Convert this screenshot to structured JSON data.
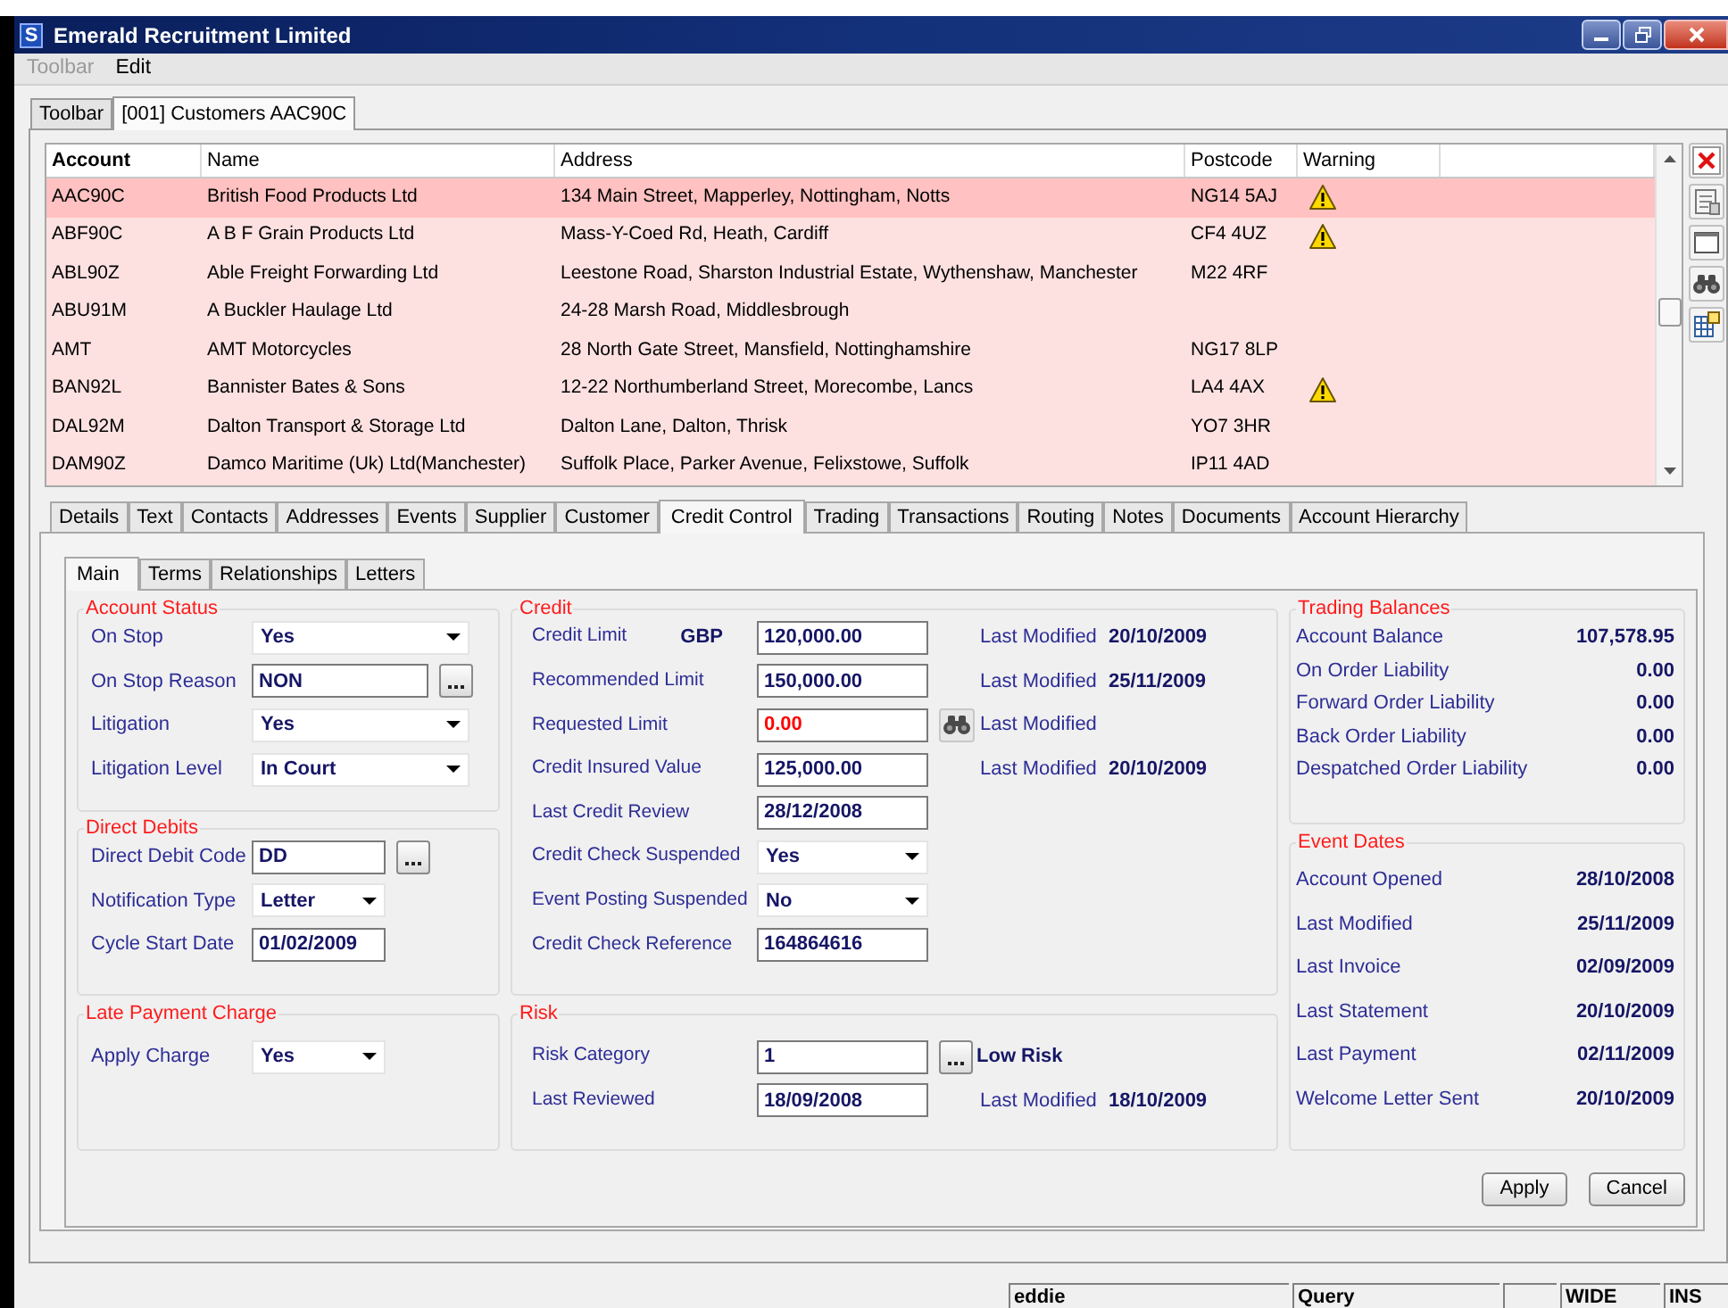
{
  "window": {
    "app_icon": "S",
    "title": "Emerald Recruitment Limited"
  },
  "menu": [
    {
      "label": "Toolbar",
      "disabled": true
    },
    {
      "label": "Edit",
      "disabled": false
    }
  ],
  "document_tabs": [
    {
      "label": "Toolbar",
      "selected": false
    },
    {
      "label": "[001] Customers AAC90C",
      "selected": true
    }
  ],
  "table": {
    "columns": [
      {
        "label": "Account",
        "sorted": true
      },
      {
        "label": "Name",
        "sorted": false
      },
      {
        "label": "Address",
        "sorted": false
      },
      {
        "label": "Postcode",
        "sorted": false
      },
      {
        "label": "Warning",
        "sorted": false
      }
    ],
    "rows": [
      {
        "account": "AAC90C",
        "name": "British Food Products Ltd",
        "address": "134 Main Street, Mapperley, Nottingham, Notts",
        "postcode": "NG14 5AJ",
        "warning": true,
        "selected": true
      },
      {
        "account": "ABF90C",
        "name": "A B F Grain Products Ltd",
        "address": "Mass-Y-Coed Rd, Heath, Cardiff",
        "postcode": "CF4 4UZ",
        "warning": true,
        "selected": false
      },
      {
        "account": "ABL90Z",
        "name": "Able Freight Forwarding Ltd",
        "address": "Leestone Road, Sharston Industrial Estate, Wythenshaw, Manchester",
        "postcode": "M22 4RF",
        "warning": false,
        "selected": false
      },
      {
        "account": "ABU91M",
        "name": "A Buckler Haulage Ltd",
        "address": "24-28 Marsh Road, Middlesbrough",
        "warning": false,
        "selected": false
      },
      {
        "account": "AMT",
        "name": "AMT Motorcycles",
        "address": "28 North Gate Street, Mansfield, Nottinghamshire",
        "postcode": "NG17 8LP",
        "warning": false,
        "selected": false
      },
      {
        "account": "BAN92L",
        "name": "Bannister Bates & Sons",
        "address": "12-22 Northumberland Street, Morecombe, Lancs",
        "postcode": "LA4 4AX",
        "warning": true,
        "selected": false
      },
      {
        "account": "DAL92M",
        "name": "Dalton Transport & Storage Ltd",
        "address": "Dalton Lane, Dalton, Thrisk",
        "postcode": "YO7 3HR",
        "warning": false,
        "selected": false
      },
      {
        "account": "DAM90Z",
        "name": "Damco Maritime (Uk) Ltd(Manchester)",
        "address": "Suffolk Place, Parker Avenue, Felixstowe, Suffolk",
        "postcode": "IP11 4AD",
        "warning": false,
        "selected": false
      }
    ]
  },
  "detail_tabs": [
    {
      "label": "Details",
      "selected": false
    },
    {
      "label": "Text",
      "selected": false
    },
    {
      "label": "Contacts",
      "selected": false
    },
    {
      "label": "Addresses",
      "selected": false
    },
    {
      "label": "Events",
      "selected": false
    },
    {
      "label": "Supplier",
      "selected": false
    },
    {
      "label": "Customer",
      "selected": false
    },
    {
      "label": "Credit Control",
      "selected": true
    },
    {
      "label": "Trading",
      "selected": false
    },
    {
      "label": "Transactions",
      "selected": false
    },
    {
      "label": "Routing",
      "selected": false
    },
    {
      "label": "Notes",
      "selected": false
    },
    {
      "label": "Documents",
      "selected": false
    },
    {
      "label": "Account Hierarchy",
      "selected": false
    }
  ],
  "sub_tabs": [
    {
      "label": "Main",
      "selected": true
    },
    {
      "label": "Terms",
      "selected": false
    },
    {
      "label": "Relationships",
      "selected": false
    },
    {
      "label": "Letters",
      "selected": false
    }
  ],
  "account_status": {
    "title": "Account Status",
    "fields": [
      {
        "label": "On Stop",
        "kind": "select",
        "value": "Yes"
      },
      {
        "label": "On Stop Reason",
        "kind": "lookup",
        "value": "NON"
      },
      {
        "label": "Litigation",
        "kind": "select",
        "value": "Yes"
      },
      {
        "label": "Litigation Level",
        "kind": "select",
        "value": "In Court"
      }
    ]
  },
  "direct_debits": {
    "title": "Direct Debits",
    "fields": [
      {
        "label": "Direct Debit Code",
        "kind": "lookup",
        "value": "DD"
      },
      {
        "label": "Notification Type",
        "kind": "select",
        "value": "Letter"
      },
      {
        "label": "Cycle Start Date",
        "kind": "input",
        "value": "01/02/2009"
      }
    ]
  },
  "late_payment_charge": {
    "title": "Late Payment Charge",
    "fields": [
      {
        "label": "Apply Charge",
        "kind": "select",
        "value": "Yes"
      }
    ]
  },
  "credit": {
    "title": "Credit",
    "rows": [
      {
        "label": "Credit Limit",
        "currency": "GBP",
        "kind": "input",
        "value": "120,000.00",
        "alert": false,
        "modified_label": "Last Modified",
        "modified_date": "20/10/2009"
      },
      {
        "label": "Recommended Limit",
        "kind": "input",
        "value": "150,000.00",
        "alert": false,
        "modified_label": "Last Modified",
        "modified_date": "25/11/2009"
      },
      {
        "label": "Requested Limit",
        "kind": "search",
        "value": "0.00",
        "alert": true,
        "modified_label": "Last Modified"
      },
      {
        "label": "Credit Insured Value",
        "kind": "input",
        "value": "125,000.00",
        "alert": false,
        "modified_label": "Last Modified",
        "modified_date": "20/10/2009"
      },
      {
        "label": "Last Credit Review",
        "kind": "input",
        "value": "28/12/2008",
        "alert": false
      },
      {
        "label": "Credit Check Suspended",
        "kind": "select",
        "value": "Yes",
        "alert": false
      },
      {
        "label": "Event Posting Suspended",
        "kind": "select",
        "value": "No",
        "alert": false
      },
      {
        "label": "Credit Check Reference",
        "kind": "input",
        "value": "164864616",
        "alert": false
      }
    ]
  },
  "risk": {
    "title": "Risk",
    "rows": [
      {
        "label": "Risk Category",
        "kind": "lookup",
        "value": "1",
        "description": "Low Risk",
        "alert": false
      },
      {
        "label": "Last Reviewed",
        "kind": "input",
        "value": "18/09/2008",
        "alert": false,
        "modified_label": "Last Modified",
        "modified_date": "18/10/2009"
      }
    ]
  },
  "trading_balances": {
    "title": "Trading Balances",
    "items": [
      {
        "label": "Account Balance",
        "value": "107,578.95"
      },
      {
        "label": "On Order Liability",
        "value": "0.00"
      },
      {
        "label": "Forward Order Liability",
        "value": "0.00"
      },
      {
        "label": "Back Order Liability",
        "value": "0.00"
      },
      {
        "label": "Despatched Order Liability",
        "value": "0.00"
      }
    ]
  },
  "event_dates": {
    "title": "Event Dates",
    "items": [
      {
        "label": "Account Opened",
        "value": "28/10/2008"
      },
      {
        "label": "Last Modified",
        "value": "25/11/2009"
      },
      {
        "label": "Last Invoice",
        "value": "02/09/2009"
      },
      {
        "label": "Last Statement",
        "value": "20/10/2009"
      },
      {
        "label": "Last Payment",
        "value": "02/11/2009"
      },
      {
        "label": "Welcome Letter Sent",
        "value": "20/10/2009"
      }
    ]
  },
  "buttons": [
    {
      "label": "Apply"
    },
    {
      "label": "Cancel"
    }
  ],
  "status_bar": {
    "user": "eddie",
    "mode": "Query",
    "width_mode": "WIDE",
    "insert_mode": "INS"
  }
}
